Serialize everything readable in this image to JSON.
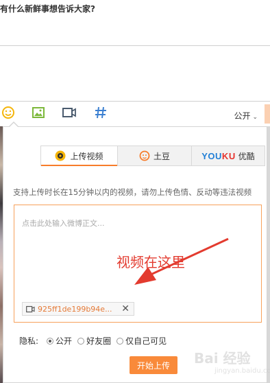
{
  "compose": {
    "title": "有什么新鲜事想告诉大家?"
  },
  "toolbar": {
    "icons": [
      "smiley-icon",
      "image-icon",
      "video-camera-icon",
      "hashtag-icon"
    ],
    "privacy_label": "公开"
  },
  "video_popup": {
    "tabs": [
      {
        "label": "上传视频",
        "active": true
      },
      {
        "label": "土豆",
        "active": false
      },
      {
        "label": "优酷",
        "logo_text": "YOUKU",
        "active": false
      }
    ],
    "hint": "支持上传时长在15分钟以内的视频，请勿上传色情、反动等违法视频",
    "input_placeholder": "点击此处输入微博正文...",
    "annotation": "视频在这里",
    "file_name": "925ff1de199b94e...",
    "privacy": {
      "label": "隐私:",
      "options": [
        {
          "label": "公开",
          "selected": true
        },
        {
          "label": "好友圈",
          "selected": false
        },
        {
          "label": "仅自己可见",
          "selected": false
        }
      ]
    },
    "upload_button": "开始上传"
  },
  "watermark": {
    "main": "Bai 经验",
    "sub": "jingyan.baidu.com"
  },
  "colors": {
    "accent": "#f77c2a",
    "button": "#f98a3a",
    "annotation": "#e33b2f",
    "icon_yellow": "#f5b50a",
    "icon_green": "#7cb83a",
    "icon_gray": "#4a5b6e",
    "icon_blue": "#3b7fd1",
    "youku_blue": "#1f7ed6",
    "youku_red": "#e6312c"
  }
}
